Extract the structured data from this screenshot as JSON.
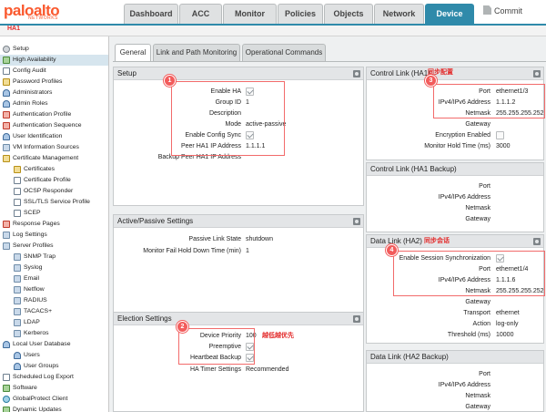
{
  "brand": {
    "name": "paloalto",
    "sub": "NETWORKS",
    "color": "#fa582d"
  },
  "top_tabs": [
    "Dashboard",
    "ACC",
    "Monitor",
    "Policies",
    "Objects",
    "Network",
    "Device"
  ],
  "active_top_tab": "Device",
  "commit_label": "Commit",
  "subbar_label": "HA1",
  "sidebar": [
    {
      "label": "Setup",
      "icon": "gear-icon"
    },
    {
      "label": "High Availability",
      "icon": "ha-icon",
      "selected": true
    },
    {
      "label": "Config Audit",
      "icon": "audit-icon"
    },
    {
      "label": "Password Profiles",
      "icon": "password-icon"
    },
    {
      "label": "Administrators",
      "icon": "admin-icon"
    },
    {
      "label": "Admin Roles",
      "icon": "role-icon"
    },
    {
      "label": "Authentication Profile",
      "icon": "auth-profile-icon"
    },
    {
      "label": "Authentication Sequence",
      "icon": "auth-sequence-icon"
    },
    {
      "label": "User Identification",
      "icon": "user-id-icon"
    },
    {
      "label": "VM Information Sources",
      "icon": "vm-icon"
    },
    {
      "label": "Certificate Management",
      "icon": "certificate-icon"
    },
    {
      "label": "Certificates",
      "icon": "certificate-icon",
      "sub": true
    },
    {
      "label": "Certificate Profile",
      "icon": "doc-icon",
      "sub": true
    },
    {
      "label": "OCSP Responder",
      "icon": "doc-icon",
      "sub": true
    },
    {
      "label": "SSL/TLS Service Profile",
      "icon": "doc-icon",
      "sub": true
    },
    {
      "label": "SCEP",
      "icon": "doc-icon",
      "sub": true
    },
    {
      "label": "Response Pages",
      "icon": "doc-icon"
    },
    {
      "label": "Log Settings",
      "icon": "log-icon"
    },
    {
      "label": "Server Profiles",
      "icon": "server-icon"
    },
    {
      "label": "SNMP Trap",
      "icon": "doc-icon",
      "sub": true
    },
    {
      "label": "Syslog",
      "icon": "doc-icon",
      "sub": true
    },
    {
      "label": "Email",
      "icon": "doc-icon",
      "sub": true
    },
    {
      "label": "Netflow",
      "icon": "doc-icon",
      "sub": true
    },
    {
      "label": "RADIUS",
      "icon": "doc-icon",
      "sub": true
    },
    {
      "label": "TACACS+",
      "icon": "doc-icon",
      "sub": true
    },
    {
      "label": "LDAP",
      "icon": "doc-icon",
      "sub": true
    },
    {
      "label": "Kerberos",
      "icon": "doc-icon",
      "sub": true
    },
    {
      "label": "Local User Database",
      "icon": "user-db-icon"
    },
    {
      "label": "Users",
      "icon": "user-icon",
      "sub": true
    },
    {
      "label": "User Groups",
      "icon": "user-group-icon",
      "sub": true
    },
    {
      "label": "Scheduled Log Export",
      "icon": "schedule-icon"
    },
    {
      "label": "Software",
      "icon": "software-icon"
    },
    {
      "label": "GlobalProtect Client",
      "icon": "globe-icon"
    },
    {
      "label": "Dynamic Updates",
      "icon": "update-icon"
    }
  ],
  "page_tabs": [
    "General",
    "Link and Path Monitoring",
    "Operational Commands"
  ],
  "active_page_tab": "General",
  "setup": {
    "title": "Setup",
    "rows": [
      {
        "key": "Enable HA",
        "checkbox": true,
        "checked": true
      },
      {
        "key": "Group ID",
        "value": "1"
      },
      {
        "key": "Description",
        "value": ""
      },
      {
        "key": "Mode",
        "value": "active-passive"
      },
      {
        "key": "Enable Config Sync",
        "checkbox": true,
        "checked": true
      },
      {
        "key": "Peer HA1 IP Address",
        "value": "1.1.1.1"
      },
      {
        "key": "Backup Peer HA1 IP Address",
        "value": ""
      }
    ]
  },
  "active_passive": {
    "title": "Active/Passive Settings",
    "rows": [
      {
        "key": "Passive Link State",
        "value": "shutdown"
      },
      {
        "key": "Monitor Fail Hold Down Time (min)",
        "value": "1"
      }
    ]
  },
  "election": {
    "title": "Election Settings",
    "rows": [
      {
        "key": "Device Priority",
        "value": "100"
      },
      {
        "key": "Preemptive",
        "checkbox": true,
        "checked": true
      },
      {
        "key": "Heartbeat Backup",
        "checkbox": true,
        "checked": true
      },
      {
        "key": "HA Timer Settings",
        "value": "Recommended"
      }
    ]
  },
  "ha1": {
    "title": "Control Link (HA1)",
    "rows": [
      {
        "key": "Port",
        "value": "ethernet1/3"
      },
      {
        "key": "IPv4/IPv6 Address",
        "value": "1.1.1.2"
      },
      {
        "key": "Netmask",
        "value": "255.255.255.252"
      },
      {
        "key": "Gateway",
        "value": ""
      },
      {
        "key": "Encryption Enabled",
        "checkbox": true,
        "checked": false
      },
      {
        "key": "Monitor Hold Time (ms)",
        "value": "3000"
      }
    ]
  },
  "ha1_backup": {
    "title": "Control Link (HA1 Backup)",
    "rows": [
      {
        "key": "Port",
        "value": ""
      },
      {
        "key": "IPv4/IPv6 Address",
        "value": ""
      },
      {
        "key": "Netmask",
        "value": ""
      },
      {
        "key": "Gateway",
        "value": ""
      }
    ]
  },
  "ha2": {
    "title": "Data Link (HA2)",
    "rows": [
      {
        "key": "Enable Session Synchronization",
        "checkbox": true,
        "checked": true
      },
      {
        "key": "Port",
        "value": "ethernet1/4"
      },
      {
        "key": "IPv4/IPv6 Address",
        "value": "1.1.1.6"
      },
      {
        "key": "Netmask",
        "value": "255.255.255.252"
      },
      {
        "key": "Gateway",
        "value": ""
      },
      {
        "key": "Transport",
        "value": "ethernet"
      },
      {
        "key": "Action",
        "value": "log-only"
      },
      {
        "key": "Threshold (ms)",
        "value": "10000"
      }
    ]
  },
  "ha2_backup": {
    "title": "Data Link (HA2 Backup)",
    "rows": [
      {
        "key": "Port",
        "value": ""
      },
      {
        "key": "IPv4/IPv6 Address",
        "value": ""
      },
      {
        "key": "Netmask",
        "value": ""
      },
      {
        "key": "Gateway",
        "value": ""
      }
    ]
  },
  "annotations": {
    "badge1": "1",
    "badge2": "2",
    "badge3": "3",
    "badge4": "4",
    "note_ha1": "同步配置",
    "note_ha2": "同步会话",
    "note_priority": "越低越优先",
    "color": "#f26b6b"
  }
}
